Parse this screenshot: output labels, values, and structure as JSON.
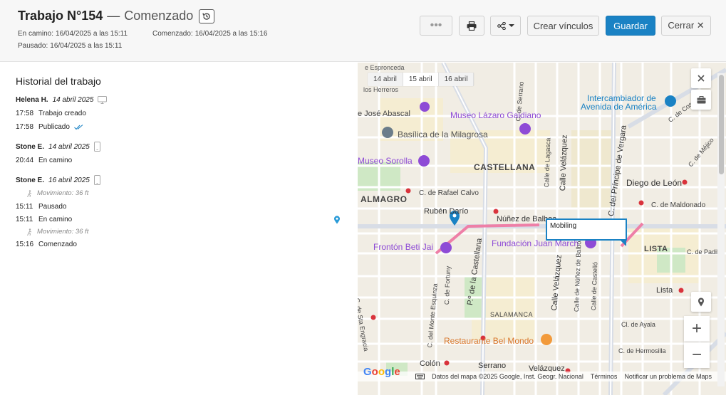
{
  "header": {
    "title": "Trabajo N°154",
    "separator": "—",
    "status": "Comenzado",
    "meta": {
      "en_camino_label": "En camino:",
      "en_camino_value": "16/04/2025 a las 15:11",
      "comenzado_label": "Comenzado:",
      "comenzado_value": "16/04/2025 a las 15:16",
      "pausado_label": "Pausado:",
      "pausado_value": "16/04/2025 a las 15:11"
    },
    "buttons": {
      "more": "•••",
      "crear_vinculos": "Crear vínculos",
      "guardar": "Guardar",
      "cerrar": "Cerrar ✕"
    },
    "colors": {
      "primary": "#1a82c4"
    }
  },
  "history": {
    "title": "Historial del trabajo",
    "groups": [
      {
        "user": "Helena H.",
        "date": "14 abril 2025",
        "device": "monitor-icon",
        "entries": [
          {
            "time": "17:58",
            "text": "Trabajo creado"
          },
          {
            "time": "17:58",
            "text": "Publicado"
          }
        ]
      },
      {
        "user": "Stone E.",
        "date": "14 abril 2025",
        "device": "phone-icon",
        "entries": [
          {
            "time": "20:44",
            "text": "En camino"
          }
        ]
      },
      {
        "user": "Stone E.",
        "date": "16 abril 2025",
        "device": "phone-icon",
        "entries": [
          {
            "time": "",
            "text": "Movimiento: 36 ft"
          },
          {
            "time": "15:11",
            "text": "Pausado"
          },
          {
            "time": "15:11",
            "text": "En camino"
          },
          {
            "time": "",
            "text": "Movimiento: 36 ft"
          },
          {
            "time": "15:16",
            "text": "Comenzado"
          }
        ]
      }
    ]
  },
  "map": {
    "date_tabs": [
      "14 abril",
      "15 abril",
      "16 abril"
    ],
    "popup": "Mobiling",
    "labels": {
      "esproceda": "e Espronceda",
      "herreros": "los Herreros",
      "abascal": "e José Abascal",
      "lazaro": "Museo Lázaro Galdiano",
      "intercambiador1": "Intercambiador de",
      "intercambiador2": "Avenida de América",
      "basilica": "Basílica de la Milagrosa",
      "sorolla": "Museo Sorolla",
      "castellana": "CASTELLANA",
      "almagro": "ALMAGRO",
      "rafael_calvo": "C. de Rafael Calvo",
      "ruben_dario": "Rubén Darío",
      "nunez": "Núñez de Balboa",
      "diego_leon": "Diego de León",
      "maldonado": "C. de Maldonado",
      "beti_jai": "Frontón Beti Jai",
      "juan_march": "Fundación Juan March",
      "lista_upper": "LISTA",
      "padilla": "C. de Padilla",
      "lista": "Lista",
      "ayala": "Cl. de Ayala",
      "salamanca": "SALAMANCA",
      "hermosilla": "C. de Hermosilla",
      "bel_mondo": "Restaurante Bel Mondo",
      "colon": "Colón",
      "serrano": "Serrano",
      "velazquez": "Velázquez",
      "cosalda": "C. de Cosalda",
      "mejico": "C. de Méjico",
      "serrano_v": "C. de Serrano",
      "lagasca_v": "Calle de Lagasca",
      "velazquez_v": "Calle Velázquez",
      "principe_v": "C. del Príncipe de Vergara",
      "castellana_v": "P.º de la Castellana",
      "fortuny_v": "C. de Fortuny",
      "monte_v": "C. del Monte Esquinza",
      "velazquez_v2": "Calle Velázquez",
      "nunez_v": "Calle de Núñez de Balboa",
      "castello_v": "Calle de Castelló",
      "santa_engracia_v": "C. de Sta Engracia"
    },
    "footer": {
      "google": "Google",
      "data": "Datos del mapa ©2025 Google, Inst. Geogr. Nacional",
      "terms": "Términos",
      "report": "Notificar un problema de Maps"
    },
    "controls": {
      "zoom_in": "+",
      "zoom_out": "−"
    }
  }
}
